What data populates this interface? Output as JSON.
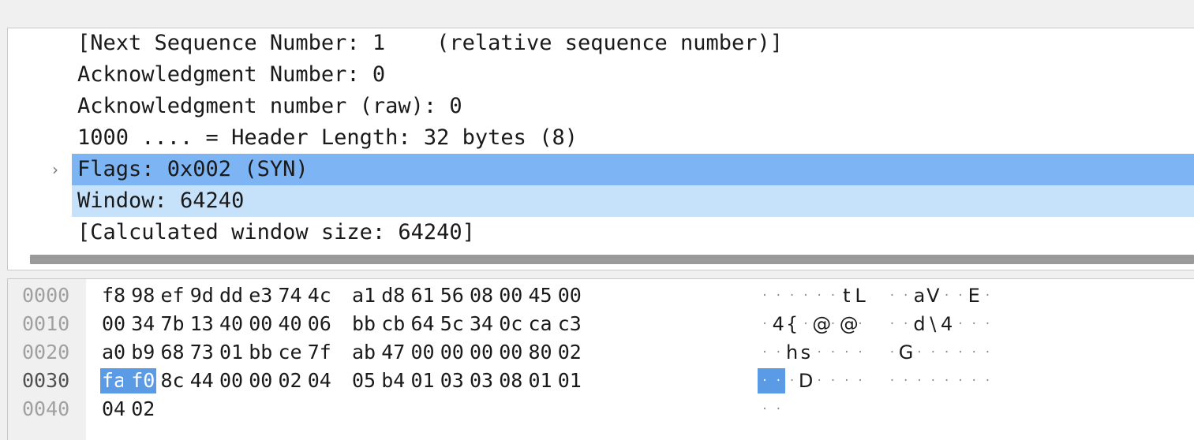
{
  "packet_details": {
    "rows": [
      {
        "text": "[Next Sequence Number: 1    (relative sequence number)]",
        "state": "normal",
        "expandable": false
      },
      {
        "text": "Acknowledgment Number: 0",
        "state": "normal",
        "expandable": false
      },
      {
        "text": "Acknowledgment number (raw): 0",
        "state": "normal",
        "expandable": false
      },
      {
        "text": "1000 .... = Header Length: 32 bytes (8)",
        "state": "normal",
        "expandable": false
      },
      {
        "text": "Flags: 0x002 (SYN)",
        "state": "selected",
        "expandable": true
      },
      {
        "text": "Window: 64240",
        "state": "related",
        "expandable": false
      },
      {
        "text": "[Calculated window size: 64240]",
        "state": "normal",
        "expandable": false
      }
    ],
    "expander_glyph": "›"
  },
  "packet_bytes": {
    "rows": [
      {
        "offset": "0000",
        "hex": [
          "f8",
          "98",
          "ef",
          "9d",
          "dd",
          "e3",
          "74",
          "4c",
          "a1",
          "d8",
          "61",
          "56",
          "08",
          "00",
          "45",
          "00"
        ],
        "ascii": [
          "·",
          "·",
          "·",
          "·",
          "·",
          "·",
          "t",
          "L",
          "·",
          "·",
          "a",
          "V",
          "·",
          "·",
          "E",
          "·"
        ]
      },
      {
        "offset": "0010",
        "hex": [
          "00",
          "34",
          "7b",
          "13",
          "40",
          "00",
          "40",
          "06",
          "bb",
          "cb",
          "64",
          "5c",
          "34",
          "0c",
          "ca",
          "c3"
        ],
        "ascii": [
          "·",
          "4",
          "{",
          "·",
          "@",
          "·",
          "@",
          "·",
          "·",
          "·",
          "d",
          "\\",
          "4",
          "·",
          "·",
          "·"
        ]
      },
      {
        "offset": "0020",
        "hex": [
          "a0",
          "b9",
          "68",
          "73",
          "01",
          "bb",
          "ce",
          "7f",
          "ab",
          "47",
          "00",
          "00",
          "00",
          "00",
          "80",
          "02"
        ],
        "ascii": [
          "·",
          "·",
          "h",
          "s",
          "·",
          "·",
          "·",
          "·",
          "·",
          "G",
          "·",
          "·",
          "·",
          "·",
          "·",
          "·"
        ]
      },
      {
        "offset": "0030",
        "hex": [
          "fa",
          "f0",
          "8c",
          "44",
          "00",
          "00",
          "02",
          "04",
          "05",
          "b4",
          "01",
          "03",
          "03",
          "08",
          "01",
          "01"
        ],
        "ascii": [
          "·",
          "·",
          "·",
          "D",
          "·",
          "·",
          "·",
          "·",
          "·",
          "·",
          "·",
          "·",
          "·",
          "·",
          "·",
          "·"
        ]
      },
      {
        "offset": "0040",
        "hex": [
          "04",
          "02"
        ],
        "ascii": [
          "·",
          "·"
        ]
      }
    ],
    "selection": {
      "row": 3,
      "start": 0,
      "end": 1
    }
  },
  "colors": {
    "selected_row": "#7cb4f4",
    "related_row": "#c6e2fb",
    "byte_highlight": "#5b9be6"
  }
}
